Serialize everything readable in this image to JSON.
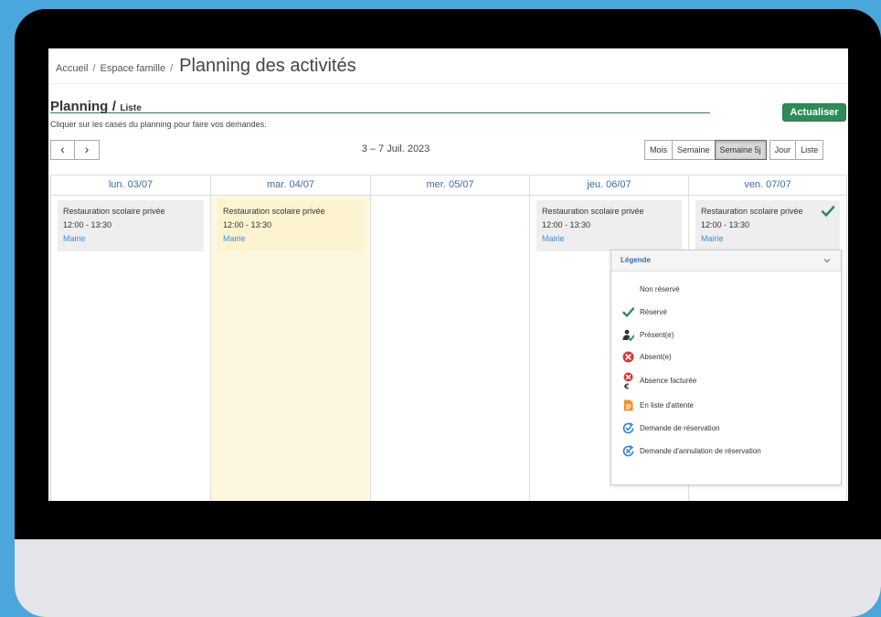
{
  "breadcrumb": {
    "home": "Accueil",
    "separator": "/",
    "section": "Espace famille",
    "current": "Planning des activités"
  },
  "planning": {
    "title": "Planning",
    "separator": "/",
    "view_link": "Liste",
    "refresh_label": "Actualiser",
    "hint": "Cliquer sur les cases du planning pour faire vos demandes.",
    "prev_label": "‹",
    "next_label": "›",
    "date_range": "3 – 7 Juil. 2023",
    "views": [
      "Mois",
      "Semaine",
      "Semaine 5j",
      "Jour",
      "Liste"
    ],
    "active_view": "Semaine 5j"
  },
  "days": [
    {
      "label": "lun. 03/07",
      "event": {
        "title": "Restauration scolaire privée",
        "time": "12:00 - 13:30",
        "place": "Mairie"
      }
    },
    {
      "label": "mar. 04/07",
      "today": true,
      "event": {
        "title": "Restauration scolaire privée",
        "time": "12:00 - 13:30",
        "place": "Mairie"
      }
    },
    {
      "label": "mer. 05/07"
    },
    {
      "label": "jeu. 06/07",
      "event": {
        "title": "Restauration scolaire privée",
        "time": "12:00 - 13:30",
        "place": "Mairie"
      }
    },
    {
      "label": "ven. 07/07",
      "event": {
        "title": "Restauration scolaire privée",
        "time": "12:00 - 13:30",
        "place": "Mairie",
        "status_icon": "check-icon"
      }
    }
  ],
  "legend": {
    "title": "Légende",
    "items": [
      {
        "label": "Non réservé",
        "icon": "none"
      },
      {
        "label": "Réservé",
        "icon": "check-icon"
      },
      {
        "label": "Présent(e)",
        "icon": "person-check-icon"
      },
      {
        "label": "Absent(e)",
        "icon": "x-circle-icon"
      },
      {
        "label": "Absence facturée",
        "icon": "x-circle-euro-icon"
      },
      {
        "label": "En liste d'attente",
        "icon": "document-icon"
      },
      {
        "label": "Demande de réservation",
        "icon": "refresh-check-icon"
      },
      {
        "label": "Demande d'annulation de réservation",
        "icon": "refresh-x-icon"
      }
    ]
  },
  "colors": {
    "frame_bg": "#4aa6db",
    "accent_green": "#2e8b57",
    "day_header_text": "#3a6da3",
    "link_blue": "#3d8fd6",
    "today_bg": "#fdf7e0",
    "absent_red": "#d9383a",
    "waitlist_orange": "#f0932b",
    "request_blue": "#2f7fd8"
  }
}
